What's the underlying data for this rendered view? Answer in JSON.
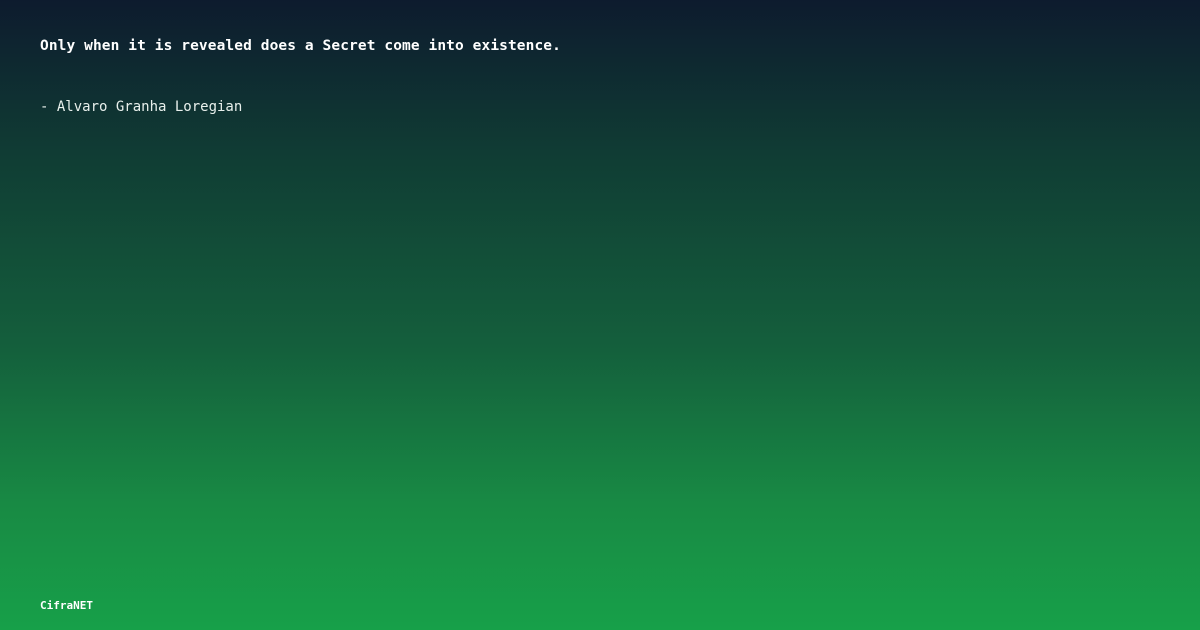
{
  "quote": {
    "text": "Only when it is revealed does a Secret come into existence.",
    "author": "- Alvaro Granha Loregian"
  },
  "brand": {
    "name": "CifraNET"
  },
  "colors": {
    "gradient_top": "#0d1b2e",
    "gradient_bottom": "#17a049",
    "text": "#ffffff"
  }
}
